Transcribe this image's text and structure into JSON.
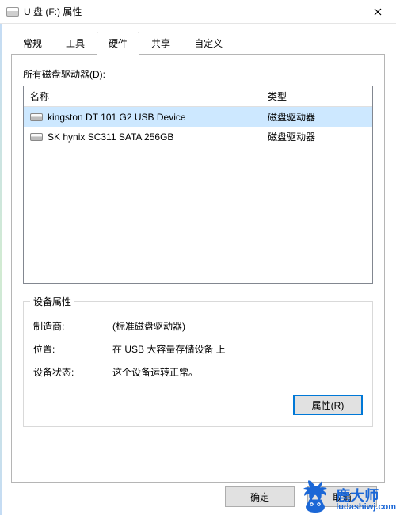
{
  "window": {
    "title": "U 盘 (F:) 属性"
  },
  "tabs": {
    "items": [
      "常规",
      "工具",
      "硬件",
      "共享",
      "自定义"
    ],
    "active_index": 2
  },
  "hardware_panel": {
    "list_label": "所有磁盘驱动器(D):",
    "columns": {
      "name": "名称",
      "type": "类型"
    },
    "rows": [
      {
        "name": "kingston DT 101 G2 USB Device",
        "type": "磁盘驱动器",
        "selected": true
      },
      {
        "name": "SK hynix SC311 SATA 256GB",
        "type": "磁盘驱动器",
        "selected": false
      }
    ],
    "group_title": "设备属性",
    "manufacturer_label": "制造商:",
    "manufacturer_value": "(标准磁盘驱动器)",
    "location_label": "位置:",
    "location_value": "在 USB 大容量存储设备 上",
    "status_label": "设备状态:",
    "status_value": "这个设备运转正常。",
    "properties_button": "属性(R)"
  },
  "dialog_buttons": {
    "ok": "确定",
    "cancel": "取消"
  },
  "watermark": {
    "cn": "鹿大师",
    "url": "ludashiwj.com"
  }
}
